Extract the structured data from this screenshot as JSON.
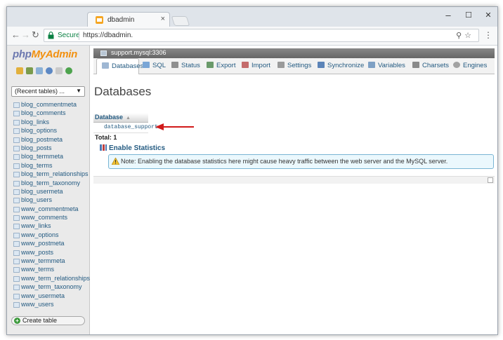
{
  "browser": {
    "tab_title": "dbadmin",
    "tab_close": "×",
    "secure_label": "Secure",
    "url": "https://dbadmin.",
    "window_minimize": "–",
    "window_maximize": "☐",
    "window_close": "✕"
  },
  "sidebar": {
    "logo_php": "php",
    "logo_myadmin": "MyAdmin",
    "recent_tables": "(Recent tables) ...",
    "tables": [
      "blog_commentmeta",
      "blog_comments",
      "blog_links",
      "blog_options",
      "blog_postmeta",
      "blog_posts",
      "blog_termmeta",
      "blog_terms",
      "blog_term_relationships",
      "blog_term_taxonomy",
      "blog_usermeta",
      "blog_users",
      "www_commentmeta",
      "www_comments",
      "www_links",
      "www_options",
      "www_postmeta",
      "www_posts",
      "www_termmeta",
      "www_terms",
      "www_term_relationships",
      "www_term_taxonomy",
      "www_usermeta",
      "www_users"
    ],
    "create_table": "Create table"
  },
  "server": {
    "label": "support.mysql:3306"
  },
  "menu": {
    "tabs": [
      "Databases",
      "SQL",
      "Status",
      "Export",
      "Import",
      "Settings",
      "Synchronize",
      "Variables",
      "Charsets",
      "Engines"
    ]
  },
  "main": {
    "title": "Databases",
    "column_header": "Database",
    "database_name": "database_support",
    "total_label": "Total: 1",
    "enable_statistics": "Enable Statistics",
    "note": "Note: Enabling the database statistics here might cause heavy traffic between the web server and the MySQL server."
  },
  "colors": {
    "link": "#235a81",
    "arrow": "#d11a1a",
    "secure": "#0b8043",
    "note_bg": "#ebf8fd"
  }
}
